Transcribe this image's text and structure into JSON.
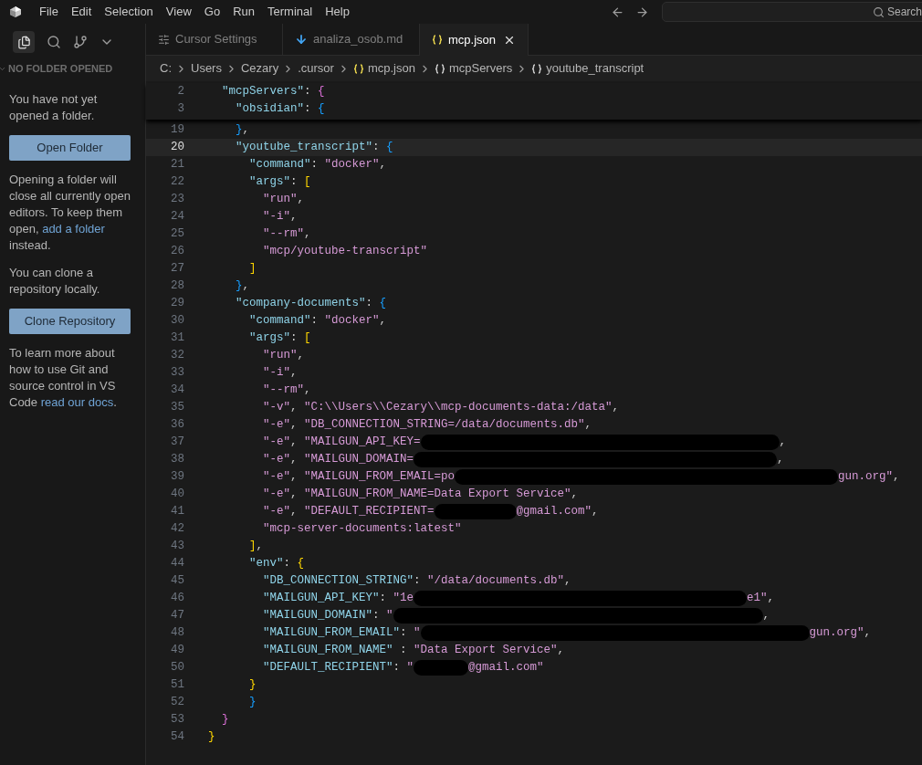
{
  "menu": [
    "File",
    "Edit",
    "Selection",
    "View",
    "Go",
    "Run",
    "Terminal",
    "Help"
  ],
  "search": {
    "placeholder": "Search"
  },
  "sidebar": {
    "header": "NO FOLDER OPENED",
    "blocks": [
      {
        "kind": "text",
        "parts": [
          {
            "text": "You have not yet opened a folder.",
            "link": false
          }
        ]
      },
      {
        "kind": "button",
        "label": "Open Folder"
      },
      {
        "kind": "text",
        "parts": [
          {
            "text": "Opening a folder will close all currently open editors. To keep them open, ",
            "link": false
          },
          {
            "text": "add a folder",
            "link": true
          },
          {
            "text": " instead.",
            "link": false
          }
        ]
      },
      {
        "kind": "text",
        "parts": [
          {
            "text": "You can clone a repository locally.",
            "link": false
          }
        ]
      },
      {
        "kind": "button",
        "label": "Clone Repository"
      },
      {
        "kind": "text",
        "parts": [
          {
            "text": "To learn more about how to use Git and source control in VS Code ",
            "link": false
          },
          {
            "text": "read our docs",
            "link": true
          },
          {
            "text": ".",
            "link": false
          }
        ]
      }
    ]
  },
  "tabs": [
    {
      "label": "Cursor Settings",
      "kind": "settings",
      "selected": false
    },
    {
      "label": "analiza_osob.md",
      "kind": "markdown",
      "selected": false
    },
    {
      "label": "mcp.json",
      "kind": "json",
      "selected": true
    }
  ],
  "breadcrumb": [
    {
      "label": "C:",
      "kind": "folder"
    },
    {
      "label": "Users",
      "kind": "folder"
    },
    {
      "label": "Cezary",
      "kind": "folder"
    },
    {
      "label": ".cursor",
      "kind": "folder"
    },
    {
      "label": "mcp.json",
      "kind": "file"
    },
    {
      "label": "mcpServers",
      "kind": "symbol"
    },
    {
      "label": "youtube_transcript",
      "kind": "symbol"
    }
  ],
  "sticky_lines": [
    {
      "number": "2",
      "parts": [
        "  \"mcpServers\": {"
      ]
    },
    {
      "number": "3",
      "parts": [
        "    \"obsidian\": {"
      ]
    }
  ],
  "lines": [
    {
      "number": "19",
      "current": false,
      "parts": [
        "    },"
      ]
    },
    {
      "number": "20",
      "current": true,
      "parts": [
        "    \"youtube_transcript\": {"
      ]
    },
    {
      "number": "21",
      "current": false,
      "parts": [
        "      \"command\": \"docker\","
      ]
    },
    {
      "number": "22",
      "current": false,
      "parts": [
        "      \"args\": ["
      ]
    },
    {
      "number": "23",
      "current": false,
      "parts": [
        "        \"run\","
      ]
    },
    {
      "number": "24",
      "current": false,
      "parts": [
        "        \"-i\","
      ]
    },
    {
      "number": "25",
      "current": false,
      "parts": [
        "        \"--rm\","
      ]
    },
    {
      "number": "26",
      "current": false,
      "parts": [
        "        \"mcp/youtube-transcript\""
      ]
    },
    {
      "number": "27",
      "current": false,
      "parts": [
        "      ]"
      ]
    },
    {
      "number": "28",
      "current": false,
      "parts": [
        "    },"
      ]
    },
    {
      "number": "29",
      "current": false,
      "parts": [
        "    \"company-documents\": {"
      ]
    },
    {
      "number": "30",
      "current": false,
      "parts": [
        "      \"command\": \"docker\","
      ]
    },
    {
      "number": "31",
      "current": false,
      "parts": [
        "      \"args\": ["
      ]
    },
    {
      "number": "32",
      "current": false,
      "parts": [
        "        \"run\","
      ]
    },
    {
      "number": "33",
      "current": false,
      "parts": [
        "        \"-i\","
      ]
    },
    {
      "number": "34",
      "current": false,
      "parts": [
        "        \"--rm\","
      ]
    },
    {
      "number": "35",
      "current": false,
      "parts": [
        "        \"-v\", \"C:\\\\Users\\\\Cezary\\\\mcp-documents-data:/data\","
      ]
    },
    {
      "number": "36",
      "current": false,
      "parts": [
        "        \"-e\", \"DB_CONNECTION_STRING=/data/documents.db\","
      ]
    },
    {
      "number": "37",
      "current": false,
      "parts": [
        "        \"-e\", \"MAILGUN_API_KEY=",
        ","
      ]
    },
    {
      "number": "38",
      "current": false,
      "parts": [
        "        \"-e\", \"MAILGUN_DOMAIN=",
        ","
      ]
    },
    {
      "number": "39",
      "current": false,
      "parts": [
        "        \"-e\", \"MAILGUN_FROM_EMAIL=po",
        "gun.org\","
      ]
    },
    {
      "number": "40",
      "current": false,
      "parts": [
        "        \"-e\", \"MAILGUN_FROM_NAME=Data Export Service\","
      ]
    },
    {
      "number": "41",
      "current": false,
      "parts": [
        "        \"-e\", \"DEFAULT_RECIPIENT=",
        "@gmail.com\","
      ]
    },
    {
      "number": "42",
      "current": false,
      "parts": [
        "        \"mcp-server-documents:latest\""
      ]
    },
    {
      "number": "43",
      "current": false,
      "parts": [
        "      ],"
      ]
    },
    {
      "number": "44",
      "current": false,
      "parts": [
        "      \"env\": {"
      ]
    },
    {
      "number": "45",
      "current": false,
      "parts": [
        "        \"DB_CONNECTION_STRING\": \"/data/documents.db\","
      ]
    },
    {
      "number": "46",
      "current": false,
      "parts": [
        "        \"MAILGUN_API_KEY\": \"1e",
        "e1\","
      ]
    },
    {
      "number": "47",
      "current": false,
      "parts": [
        "        \"MAILGUN_DOMAIN\": \"",
        ","
      ]
    },
    {
      "number": "48",
      "current": false,
      "parts": [
        "        \"MAILGUN_FROM_EMAIL\": \"",
        "gun.org\","
      ]
    },
    {
      "number": "49",
      "current": false,
      "parts": [
        "        \"MAILGUN_FROM_NAME\" : \"Data Export Service\","
      ]
    },
    {
      "number": "50",
      "current": false,
      "parts": [
        "        \"DEFAULT_RECIPIENT\": \"",
        "@gmail.com\""
      ]
    },
    {
      "number": "51",
      "current": false,
      "parts": [
        "      }"
      ]
    },
    {
      "number": "52",
      "current": false,
      "parts": [
        "      }"
      ]
    },
    {
      "number": "53",
      "current": false,
      "parts": [
        "  }"
      ]
    },
    {
      "number": "54",
      "current": false,
      "parts": [
        "}"
      ]
    }
  ]
}
